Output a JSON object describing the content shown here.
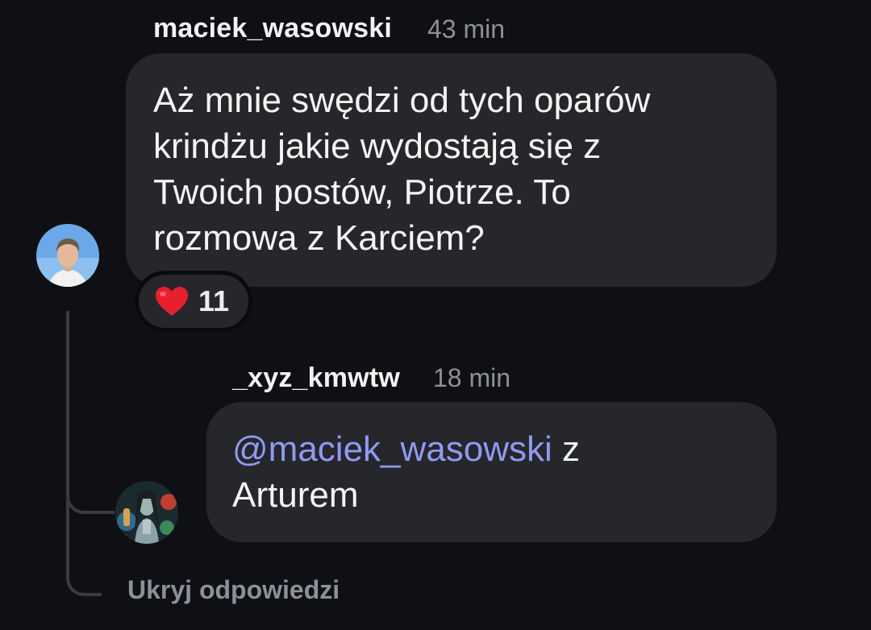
{
  "comment": {
    "username": "maciek_wasowski",
    "time": "43 min",
    "lines": [
      "Aż mnie swędzi od tych oparów",
      "krindżu jakie wydostają się z",
      "Twoich postów, Piotrze. To",
      "rozmowa z Karciem?"
    ],
    "reaction": {
      "icon": "heart-icon",
      "emoji": "❤️",
      "count": "11"
    }
  },
  "reply": {
    "username": "_xyz_kmwtw",
    "time": "18 min",
    "mention": "@maciek_wasowski",
    "line1_rest": " z",
    "line2": "Arturem"
  },
  "hide_replies_label": "Ukryj odpowiedzi",
  "colors": {
    "background": "#0f1014",
    "bubble": "#26272b",
    "mention": "#8f9af3",
    "muted_text": "#8e9099"
  }
}
